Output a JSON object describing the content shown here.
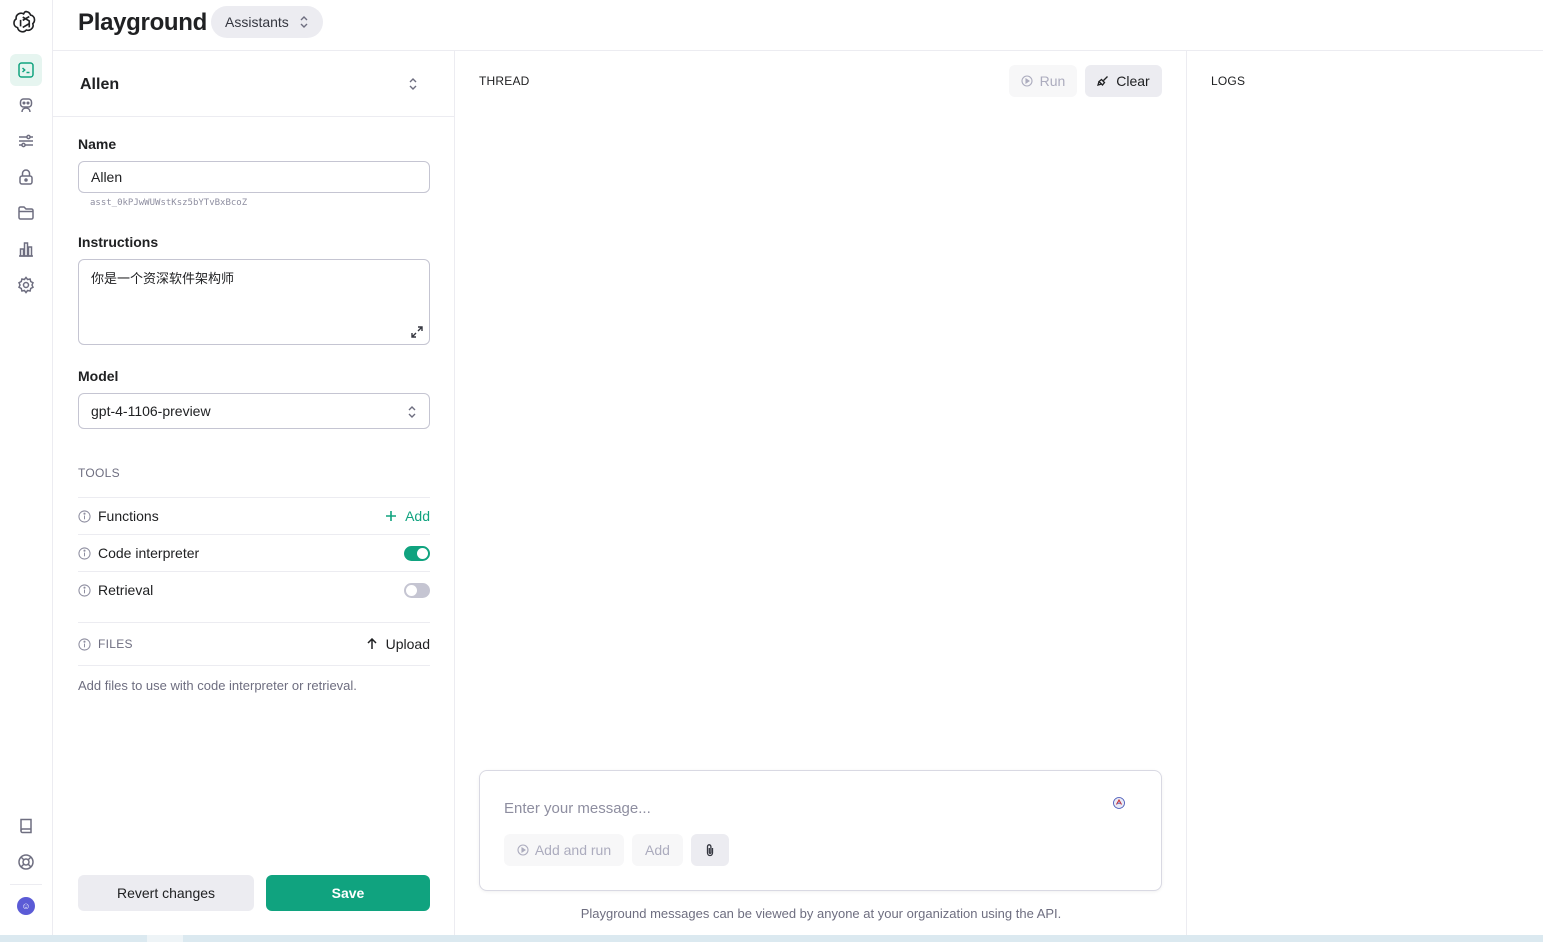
{
  "header": {
    "title": "Playground",
    "mode": "Assistants"
  },
  "assistant_panel": {
    "selected_assistant": "Allen",
    "name_label": "Name",
    "name_value": "Allen",
    "assistant_id": "asst_0kPJwWUWstKsz5bYTvBxBcoZ",
    "instructions_label": "Instructions",
    "instructions_value": "你是一个资深软件架构师",
    "model_label": "Model",
    "model_value": "gpt-4-1106-preview",
    "tools_caption": "TOOLS",
    "tools": [
      {
        "label": "Functions",
        "action": "Add"
      },
      {
        "label": "Code interpreter",
        "enabled": true
      },
      {
        "label": "Retrieval",
        "enabled": false
      }
    ],
    "files_caption": "FILES",
    "upload_label": "Upload",
    "files_hint": "Add files to use with code interpreter or retrieval.",
    "revert_label": "Revert changes",
    "save_label": "Save"
  },
  "thread": {
    "caption": "THREAD",
    "run_label": "Run",
    "clear_label": "Clear",
    "message_placeholder": "Enter your message...",
    "add_and_run_label": "Add and run",
    "add_label": "Add",
    "disclaimer": "Playground messages can be viewed by anyone at your organization using the API."
  },
  "logs": {
    "caption": "LOGS"
  },
  "colors": {
    "accent": "#10a37f",
    "muted_text": "#6e6e80",
    "border": "#ececf1"
  },
  "rail_icons": [
    "openai-logo-icon",
    "terminal-icon",
    "assistant-bot-icon",
    "sliders-icon",
    "lock-icon",
    "folder-icon",
    "bar-chart-icon",
    "gear-icon",
    "book-icon",
    "lifebuoy-icon"
  ]
}
